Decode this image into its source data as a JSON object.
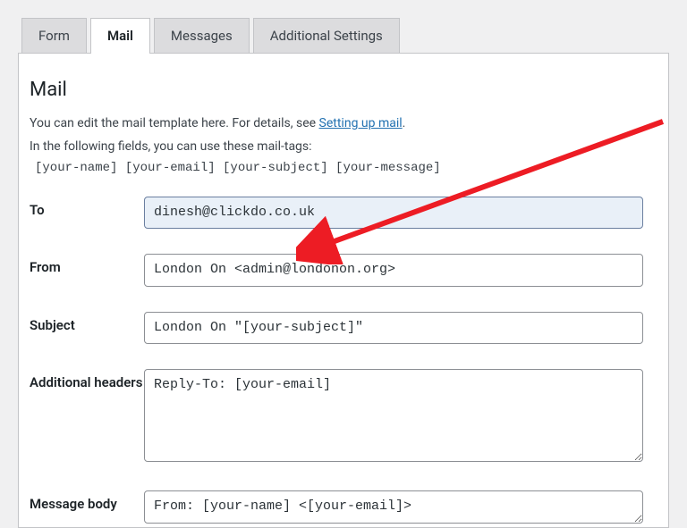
{
  "tabs": {
    "form": "Form",
    "mail": "Mail",
    "messages": "Messages",
    "additional": "Additional Settings"
  },
  "panel": {
    "heading": "Mail",
    "desc_prefix": "You can edit the mail template here. For details, see ",
    "desc_link": "Setting up mail",
    "desc_suffix": ".",
    "desc_line2": "In the following fields, you can use these mail-tags:",
    "mailtags": "[your-name] [your-email] [your-subject] [your-message]"
  },
  "fields": {
    "to": {
      "label": "To",
      "value": "dinesh@clickdo.co.uk"
    },
    "from": {
      "label": "From",
      "value": "London On <admin@londonon.org>"
    },
    "subject": {
      "label": "Subject",
      "value": "London On \"[your-subject]\""
    },
    "headers": {
      "label": "Additional headers",
      "value": "Reply-To: [your-email]"
    },
    "body": {
      "label": "Message body",
      "value": "From: [your-name] <[your-email]>"
    }
  }
}
